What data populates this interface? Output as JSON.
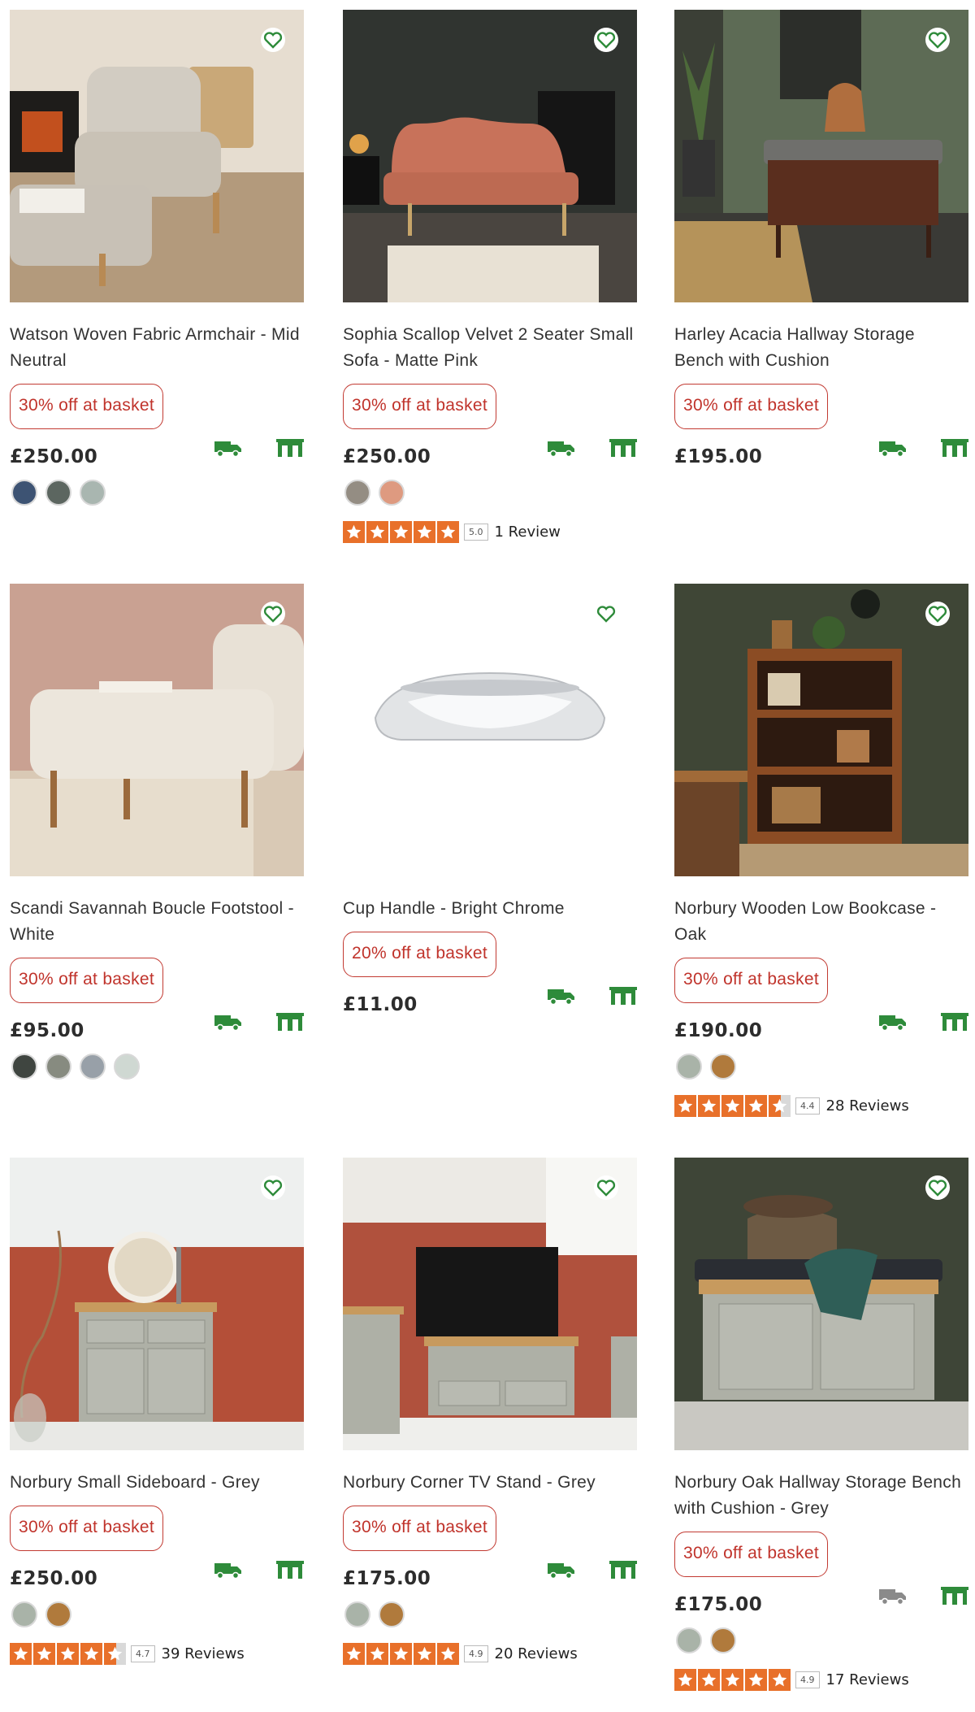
{
  "colors": {
    "promo": "#c0332b",
    "green": "#2e8b3a",
    "grey_icon": "#8a8a8a",
    "star": "#e8702a"
  },
  "products": [
    {
      "title": "Watson Woven Fabric Armchair - Mid Neutral",
      "promo": "30% off at basket",
      "price": "£250.00",
      "swatches": [
        "#3d5373",
        "#5c6660",
        "#a9b6b0"
      ],
      "rating": null,
      "reviews": null,
      "delivery": "green"
    },
    {
      "title": "Sophia Scallop Velvet 2 Seater Small Sofa - Matte Pink",
      "promo": "30% off at basket",
      "price": "£250.00",
      "swatches": [
        "#948d83",
        "#de9a80"
      ],
      "rating": "5.0",
      "reviews": "1 Review",
      "stars": 5,
      "delivery": "green"
    },
    {
      "title": "Harley Acacia Hallway Storage Bench with Cushion",
      "promo": "30% off at basket",
      "price": "£195.00",
      "swatches": [],
      "rating": null,
      "reviews": null,
      "delivery": "green"
    },
    {
      "title": "Scandi Savannah Boucle Footstool - White",
      "promo": "30% off at basket",
      "price": "£95.00",
      "swatches": [
        "#3f4540",
        "#878b80",
        "#98a0a8",
        "#cfd8d2"
      ],
      "rating": null,
      "reviews": null,
      "delivery": "green"
    },
    {
      "title": "Cup Handle - Bright Chrome",
      "promo": "20% off at basket",
      "price": "£11.00",
      "swatches": [],
      "rating": null,
      "reviews": null,
      "delivery": "green"
    },
    {
      "title": "Norbury Wooden Low Bookcase - Oak",
      "promo": "30% off at basket",
      "price": "£190.00",
      "swatches": [
        "#a9b3a8",
        "#b07a3c"
      ],
      "rating": "4.4",
      "reviews": "28 Reviews",
      "stars": 4.5,
      "delivery": "green"
    },
    {
      "title": "Norbury Small Sideboard - Grey",
      "promo": "30% off at basket",
      "price": "£250.00",
      "swatches": [
        "#a9b3a8",
        "#b07a3c"
      ],
      "rating": "4.7",
      "reviews": "39 Reviews",
      "stars": 4.5,
      "delivery": "green"
    },
    {
      "title": "Norbury Corner TV Stand - Grey",
      "promo": "30% off at basket",
      "price": "£175.00",
      "swatches": [
        "#a9b3a8",
        "#b07a3c"
      ],
      "rating": "4.9",
      "reviews": "20 Reviews",
      "stars": 5,
      "delivery": "green"
    },
    {
      "title": "Norbury Oak Hallway Storage Bench with Cushion - Grey",
      "promo": "30% off at basket",
      "price": "£175.00",
      "swatches": [
        "#a9b3a8",
        "#b07a3c"
      ],
      "rating": "4.9",
      "reviews": "17 Reviews",
      "stars": 5,
      "delivery": "grey"
    }
  ]
}
